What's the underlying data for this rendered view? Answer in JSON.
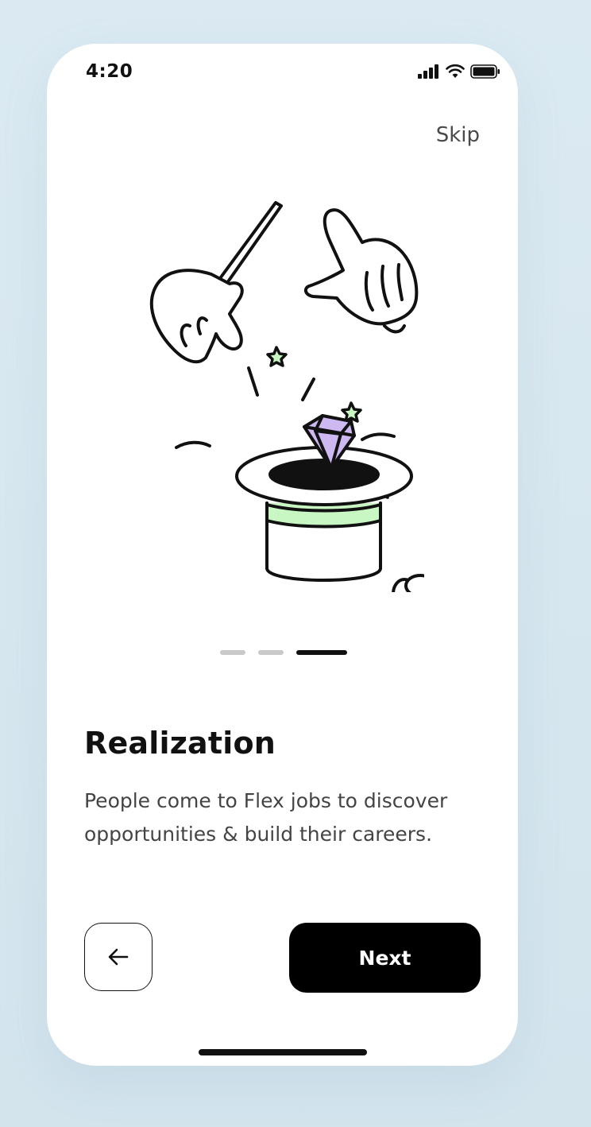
{
  "status_bar": {
    "time": "4:20"
  },
  "header": {
    "skip_label": "Skip"
  },
  "illustration": {
    "description_icon": "magic-hat-diamond-illustration",
    "accent_green": "#c9f7c4",
    "accent_purple": "#cdb8f2"
  },
  "pagination": {
    "total": 3,
    "active_index": 2
  },
  "content": {
    "title": "Realization",
    "description": "People come to Flex jobs to discover opportunities & build their careers."
  },
  "actions": {
    "back_icon": "arrow-left-icon",
    "next_label": "Next"
  }
}
